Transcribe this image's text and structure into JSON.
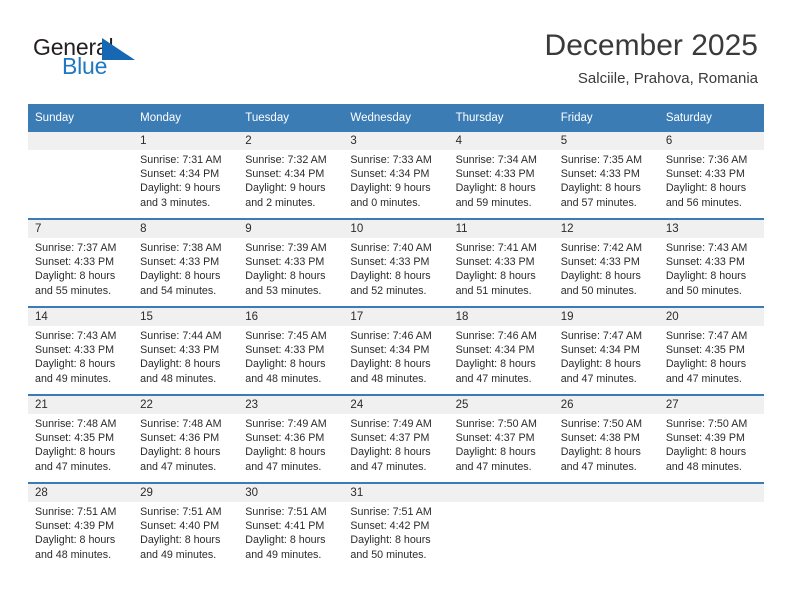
{
  "brand": {
    "name_part1": "General",
    "name_part2": "Blue",
    "logo_color": "#1668b3"
  },
  "header": {
    "title": "December 2025",
    "subtitle": "Salciile, Prahova, Romania"
  },
  "calendar": {
    "header_bg": "#3c7cb5",
    "daynum_bg": "#f0f0f0",
    "weekdays": [
      "Sunday",
      "Monday",
      "Tuesday",
      "Wednesday",
      "Thursday",
      "Friday",
      "Saturday"
    ],
    "weeks": [
      [
        {
          "day": "",
          "lines": []
        },
        {
          "day": "1",
          "lines": [
            "Sunrise: 7:31 AM",
            "Sunset: 4:34 PM",
            "Daylight: 9 hours",
            "and 3 minutes."
          ]
        },
        {
          "day": "2",
          "lines": [
            "Sunrise: 7:32 AM",
            "Sunset: 4:34 PM",
            "Daylight: 9 hours",
            "and 2 minutes."
          ]
        },
        {
          "day": "3",
          "lines": [
            "Sunrise: 7:33 AM",
            "Sunset: 4:34 PM",
            "Daylight: 9 hours",
            "and 0 minutes."
          ]
        },
        {
          "day": "4",
          "lines": [
            "Sunrise: 7:34 AM",
            "Sunset: 4:33 PM",
            "Daylight: 8 hours",
            "and 59 minutes."
          ]
        },
        {
          "day": "5",
          "lines": [
            "Sunrise: 7:35 AM",
            "Sunset: 4:33 PM",
            "Daylight: 8 hours",
            "and 57 minutes."
          ]
        },
        {
          "day": "6",
          "lines": [
            "Sunrise: 7:36 AM",
            "Sunset: 4:33 PM",
            "Daylight: 8 hours",
            "and 56 minutes."
          ]
        }
      ],
      [
        {
          "day": "7",
          "lines": [
            "Sunrise: 7:37 AM",
            "Sunset: 4:33 PM",
            "Daylight: 8 hours",
            "and 55 minutes."
          ]
        },
        {
          "day": "8",
          "lines": [
            "Sunrise: 7:38 AM",
            "Sunset: 4:33 PM",
            "Daylight: 8 hours",
            "and 54 minutes."
          ]
        },
        {
          "day": "9",
          "lines": [
            "Sunrise: 7:39 AM",
            "Sunset: 4:33 PM",
            "Daylight: 8 hours",
            "and 53 minutes."
          ]
        },
        {
          "day": "10",
          "lines": [
            "Sunrise: 7:40 AM",
            "Sunset: 4:33 PM",
            "Daylight: 8 hours",
            "and 52 minutes."
          ]
        },
        {
          "day": "11",
          "lines": [
            "Sunrise: 7:41 AM",
            "Sunset: 4:33 PM",
            "Daylight: 8 hours",
            "and 51 minutes."
          ]
        },
        {
          "day": "12",
          "lines": [
            "Sunrise: 7:42 AM",
            "Sunset: 4:33 PM",
            "Daylight: 8 hours",
            "and 50 minutes."
          ]
        },
        {
          "day": "13",
          "lines": [
            "Sunrise: 7:43 AM",
            "Sunset: 4:33 PM",
            "Daylight: 8 hours",
            "and 50 minutes."
          ]
        }
      ],
      [
        {
          "day": "14",
          "lines": [
            "Sunrise: 7:43 AM",
            "Sunset: 4:33 PM",
            "Daylight: 8 hours",
            "and 49 minutes."
          ]
        },
        {
          "day": "15",
          "lines": [
            "Sunrise: 7:44 AM",
            "Sunset: 4:33 PM",
            "Daylight: 8 hours",
            "and 48 minutes."
          ]
        },
        {
          "day": "16",
          "lines": [
            "Sunrise: 7:45 AM",
            "Sunset: 4:33 PM",
            "Daylight: 8 hours",
            "and 48 minutes."
          ]
        },
        {
          "day": "17",
          "lines": [
            "Sunrise: 7:46 AM",
            "Sunset: 4:34 PM",
            "Daylight: 8 hours",
            "and 48 minutes."
          ]
        },
        {
          "day": "18",
          "lines": [
            "Sunrise: 7:46 AM",
            "Sunset: 4:34 PM",
            "Daylight: 8 hours",
            "and 47 minutes."
          ]
        },
        {
          "day": "19",
          "lines": [
            "Sunrise: 7:47 AM",
            "Sunset: 4:34 PM",
            "Daylight: 8 hours",
            "and 47 minutes."
          ]
        },
        {
          "day": "20",
          "lines": [
            "Sunrise: 7:47 AM",
            "Sunset: 4:35 PM",
            "Daylight: 8 hours",
            "and 47 minutes."
          ]
        }
      ],
      [
        {
          "day": "21",
          "lines": [
            "Sunrise: 7:48 AM",
            "Sunset: 4:35 PM",
            "Daylight: 8 hours",
            "and 47 minutes."
          ]
        },
        {
          "day": "22",
          "lines": [
            "Sunrise: 7:48 AM",
            "Sunset: 4:36 PM",
            "Daylight: 8 hours",
            "and 47 minutes."
          ]
        },
        {
          "day": "23",
          "lines": [
            "Sunrise: 7:49 AM",
            "Sunset: 4:36 PM",
            "Daylight: 8 hours",
            "and 47 minutes."
          ]
        },
        {
          "day": "24",
          "lines": [
            "Sunrise: 7:49 AM",
            "Sunset: 4:37 PM",
            "Daylight: 8 hours",
            "and 47 minutes."
          ]
        },
        {
          "day": "25",
          "lines": [
            "Sunrise: 7:50 AM",
            "Sunset: 4:37 PM",
            "Daylight: 8 hours",
            "and 47 minutes."
          ]
        },
        {
          "day": "26",
          "lines": [
            "Sunrise: 7:50 AM",
            "Sunset: 4:38 PM",
            "Daylight: 8 hours",
            "and 47 minutes."
          ]
        },
        {
          "day": "27",
          "lines": [
            "Sunrise: 7:50 AM",
            "Sunset: 4:39 PM",
            "Daylight: 8 hours",
            "and 48 minutes."
          ]
        }
      ],
      [
        {
          "day": "28",
          "lines": [
            "Sunrise: 7:51 AM",
            "Sunset: 4:39 PM",
            "Daylight: 8 hours",
            "and 48 minutes."
          ]
        },
        {
          "day": "29",
          "lines": [
            "Sunrise: 7:51 AM",
            "Sunset: 4:40 PM",
            "Daylight: 8 hours",
            "and 49 minutes."
          ]
        },
        {
          "day": "30",
          "lines": [
            "Sunrise: 7:51 AM",
            "Sunset: 4:41 PM",
            "Daylight: 8 hours",
            "and 49 minutes."
          ]
        },
        {
          "day": "31",
          "lines": [
            "Sunrise: 7:51 AM",
            "Sunset: 4:42 PM",
            "Daylight: 8 hours",
            "and 50 minutes."
          ]
        },
        {
          "day": "",
          "lines": []
        },
        {
          "day": "",
          "lines": []
        },
        {
          "day": "",
          "lines": []
        }
      ]
    ]
  }
}
